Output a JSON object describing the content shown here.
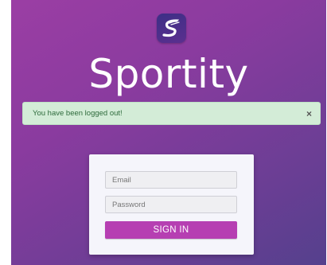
{
  "app": {
    "brand_name": "Sportity",
    "logo_icon": "sportity-s-logo-icon"
  },
  "alert": {
    "message": "You have been logged out!",
    "close_label": "×",
    "background": "#d3ecd7"
  },
  "login": {
    "email_placeholder": "Email",
    "email_value": "",
    "password_placeholder": "Password",
    "password_value": "",
    "submit_label": "SIGN IN",
    "submit_color": "#b63fb2"
  },
  "theme": {
    "background_gradient": [
      "#9b3ea4",
      "#55408d"
    ]
  }
}
